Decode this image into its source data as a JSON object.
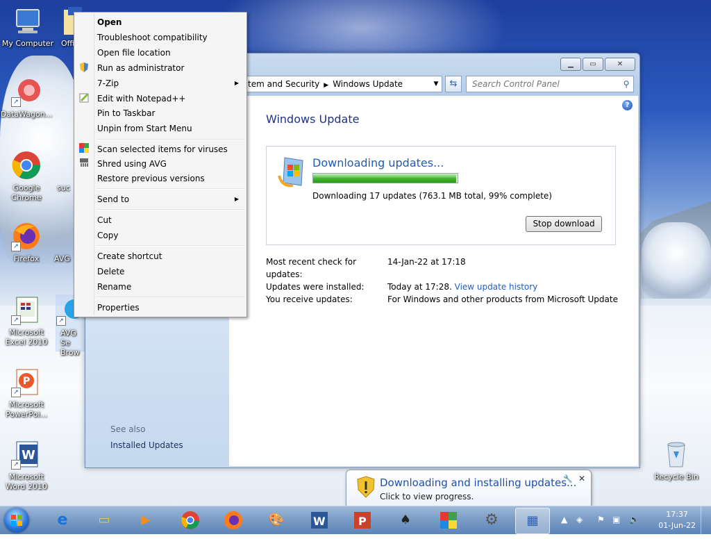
{
  "desktop": {
    "icons": [
      {
        "label": "My Computer"
      },
      {
        "label": "Offi"
      },
      {
        "label": "DataWagon..."
      },
      {
        "label": "Google Chrome"
      },
      {
        "label": "suc"
      },
      {
        "label": "Firefox"
      },
      {
        "label": "AVG"
      },
      {
        "label": "Microsoft Excel 2010"
      },
      {
        "label": "AVG Se Brow"
      },
      {
        "label": "Microsoft PowerPoi..."
      },
      {
        "label": "Microsoft Word 2010"
      },
      {
        "label": "Recycle Bin"
      }
    ]
  },
  "context_menu": {
    "items": [
      {
        "label": "Open"
      },
      {
        "label": "Troubleshoot compatibility"
      },
      {
        "label": "Open file location"
      },
      {
        "label": "Run as administrator"
      },
      {
        "label": "7-Zip"
      },
      {
        "label": "Edit with Notepad++"
      },
      {
        "label": "Pin to Taskbar"
      },
      {
        "label": "Unpin from Start Menu"
      },
      {
        "label": "Scan selected items for viruses"
      },
      {
        "label": "Shred using AVG"
      },
      {
        "label": "Restore previous versions"
      },
      {
        "label": "Send to"
      },
      {
        "label": "Cut"
      },
      {
        "label": "Copy"
      },
      {
        "label": "Create shortcut"
      },
      {
        "label": "Delete"
      },
      {
        "label": "Rename"
      },
      {
        "label": "Properties"
      }
    ]
  },
  "window": {
    "breadcrumb": [
      "tem and Security",
      "Windows Update"
    ],
    "search_placeholder": "Search Control Panel",
    "sidebar": {
      "see_also": "See also",
      "installed_updates": "Installed Updates"
    },
    "title": "Windows Update",
    "download": {
      "title": "Downloading updates...",
      "progress": 0.99,
      "detail": "Downloading 17 updates (763.1 MB total, 99% complete)",
      "stop_label": "Stop download"
    },
    "info": {
      "recent_check_label": "Most recent check for updates:",
      "recent_check_value": "14-Jan-22 at 17:18",
      "installed_label": "Updates were installed:",
      "installed_value": "Today at 17:28.",
      "history_link": "View update history",
      "receive_label": "You receive updates:",
      "receive_value": "For Windows and other products from Microsoft Update"
    }
  },
  "balloon": {
    "title": "Downloading and installing updates...",
    "subtitle": "Click to view progress."
  },
  "taskbar": {
    "time": "17:37",
    "date": "01-Jun-22"
  }
}
